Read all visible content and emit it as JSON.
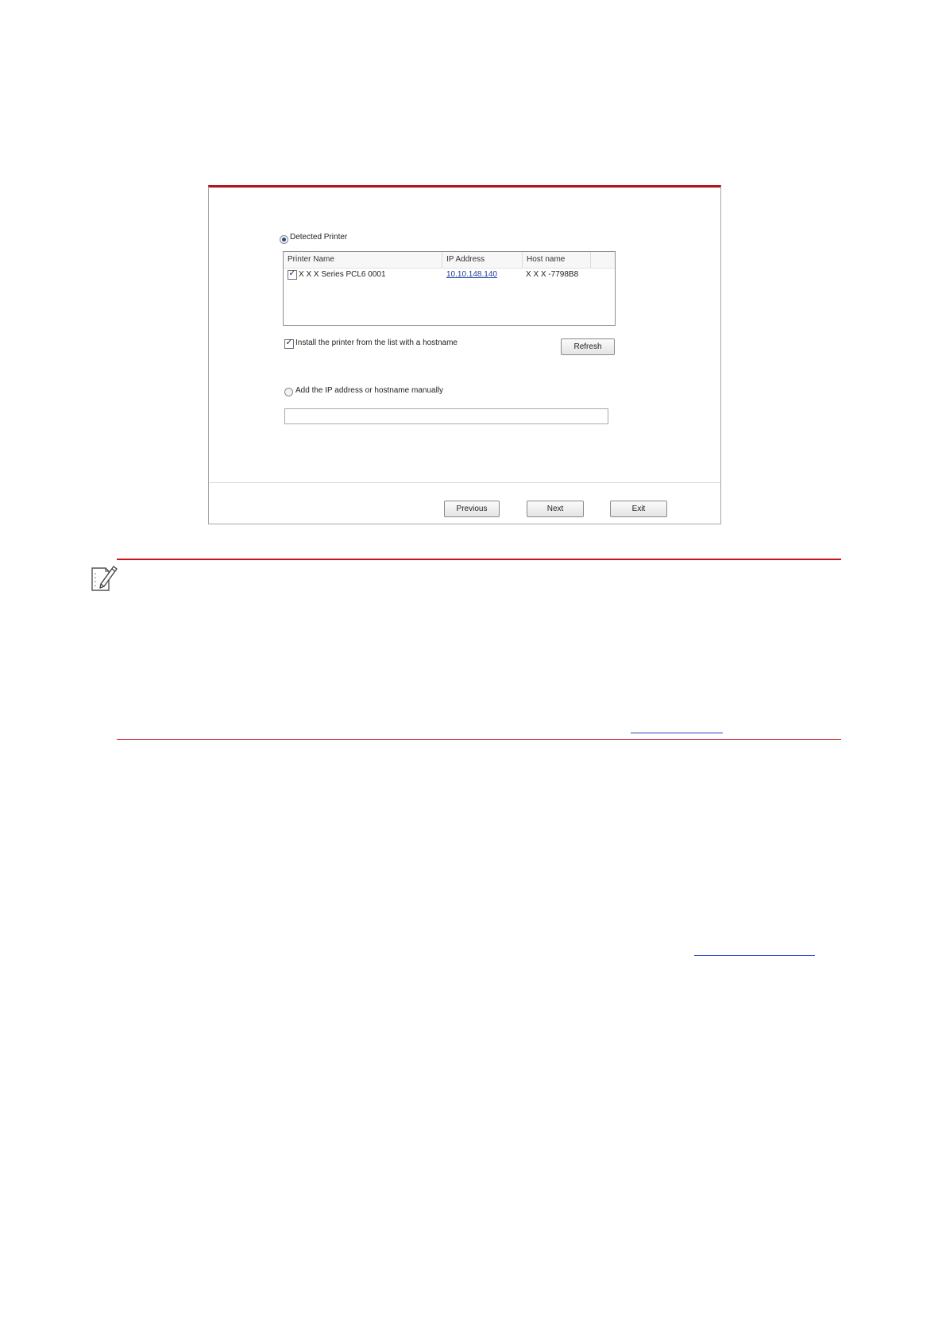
{
  "dialog": {
    "detected_radio_label": "Detected Printer",
    "table": {
      "columns": [
        "Printer Name",
        "IP Address",
        "Host name"
      ],
      "rows": [
        {
          "checked": true,
          "printer_name": "X X X  Series PCL6 0001",
          "ip_address": "10.10.148.140",
          "host_name": "X X X -7798B8"
        }
      ]
    },
    "install_hostname_checkbox_label": "Install the printer from the list with a hostname",
    "refresh_label": "Refresh",
    "manual_radio_label": "Add the IP address or hostname manually",
    "manual_input_value": "",
    "buttons": {
      "previous": "Previous",
      "next": "Next",
      "exit": "Exit"
    }
  },
  "colors": {
    "accent_red": "#b3121b",
    "link_blue": "#1a3da0"
  },
  "icons": {
    "note": "note-pencil-icon",
    "check": "checkmark-icon"
  }
}
